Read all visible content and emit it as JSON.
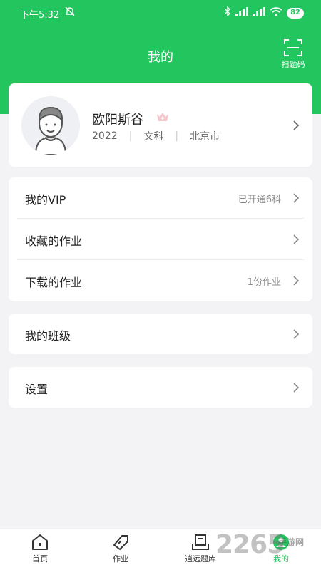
{
  "status_bar": {
    "time": "下午5:32",
    "battery": "82"
  },
  "nav": {
    "title": "我的",
    "scan_label": "扫题码"
  },
  "profile": {
    "name": "欧阳斯谷",
    "year": "2022",
    "subject": "文科",
    "city": "北京市"
  },
  "menu_group1": [
    {
      "label": "我的VIP",
      "value": "已开通6科"
    },
    {
      "label": "收藏的作业",
      "value": ""
    },
    {
      "label": "下载的作业",
      "value": "1份作业"
    }
  ],
  "menu_group2": [
    {
      "label": "我的班级"
    }
  ],
  "menu_group3": [
    {
      "label": "设置"
    }
  ],
  "tabbar": [
    {
      "label": "首页",
      "icon": "home-icon"
    },
    {
      "label": "作业",
      "icon": "tag-icon"
    },
    {
      "label": "逍远题库",
      "icon": "book-icon"
    },
    {
      "label": "我的",
      "icon": "profile-icon",
      "active": true
    }
  ],
  "watermark": {
    "text": "2265",
    "small": "手游网"
  },
  "colors": {
    "accent": "#22c55e",
    "background": "#f3f3f5"
  }
}
